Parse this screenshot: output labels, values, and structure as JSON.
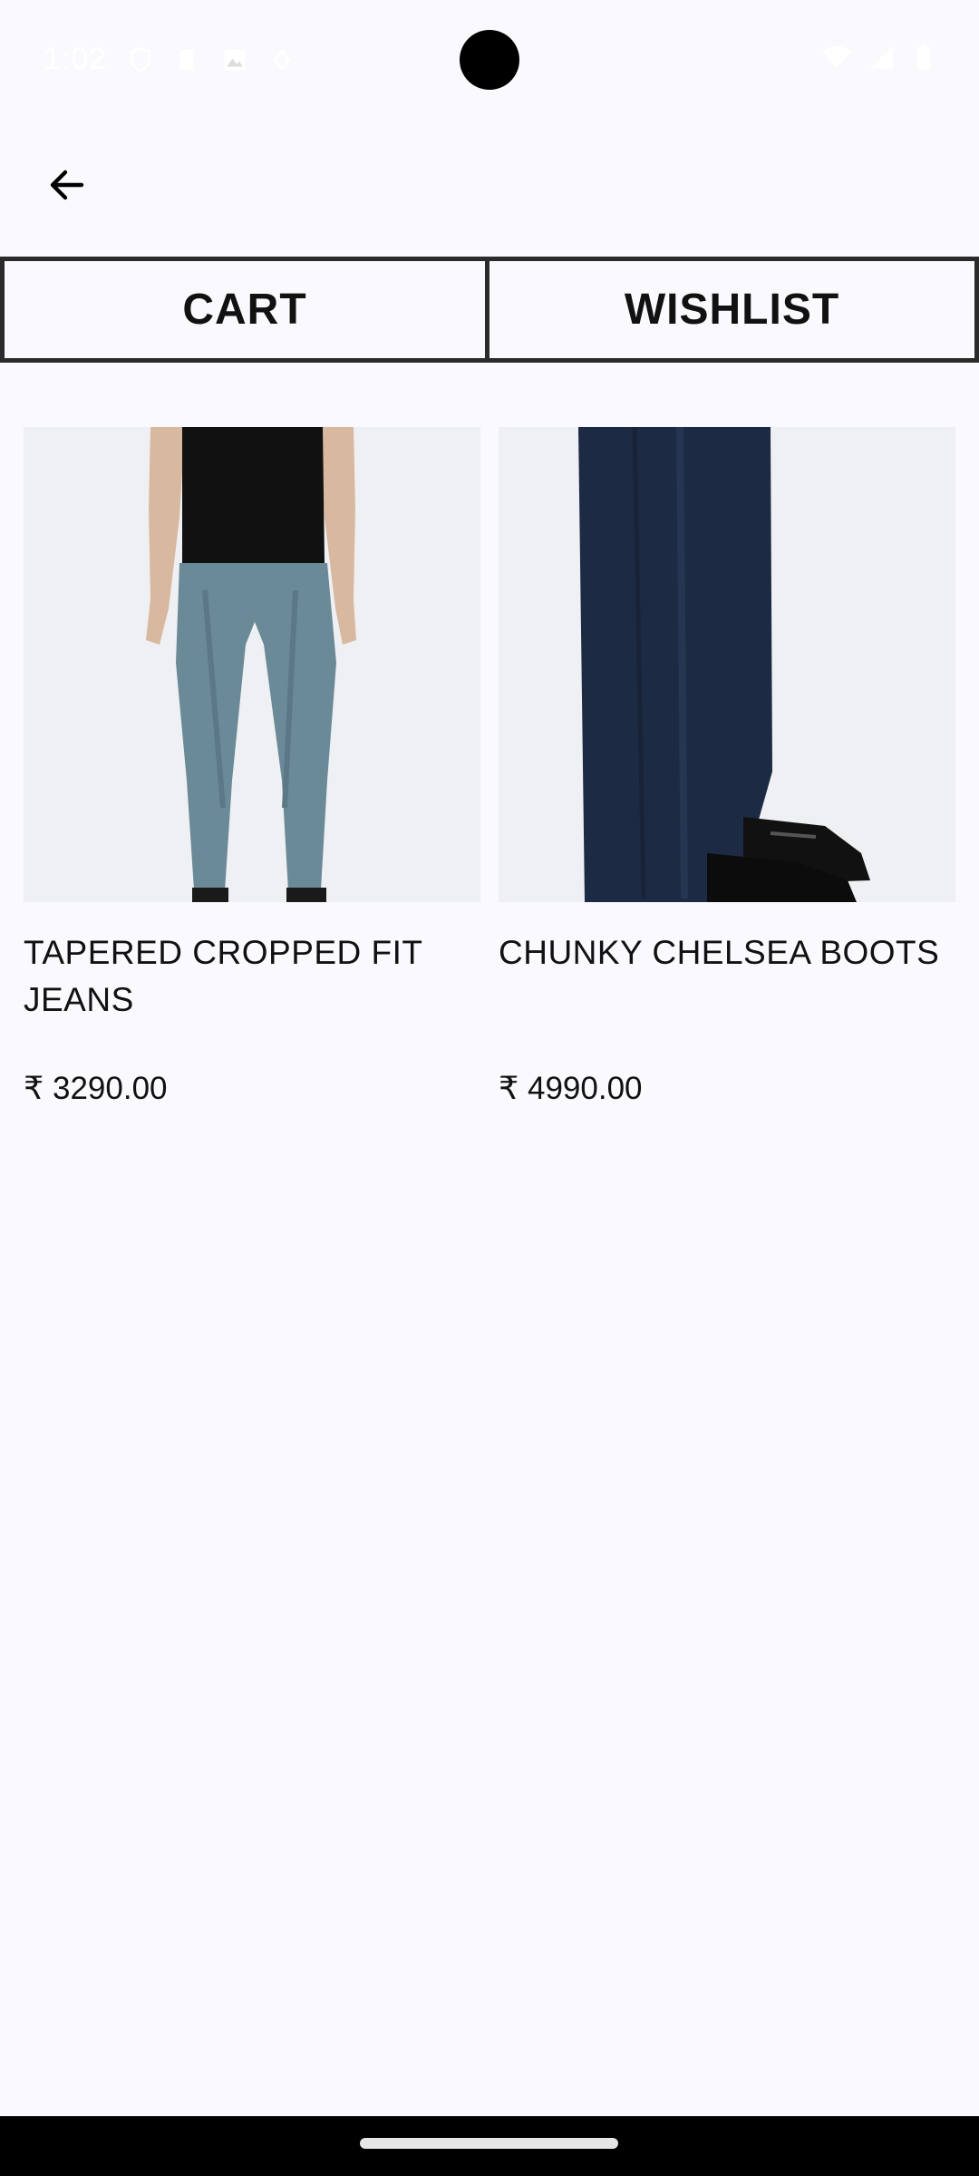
{
  "status_bar": {
    "time": "1:02",
    "left_icons": [
      "shield-icon",
      "sd-card-icon",
      "image-icon",
      "vpn-icon"
    ],
    "right_icons": [
      "wifi-icon",
      "signal-icon",
      "battery-icon"
    ]
  },
  "toolbar": {
    "back_icon": "arrow-left-icon"
  },
  "tabs": [
    {
      "label": "CART"
    },
    {
      "label": "WISHLIST"
    }
  ],
  "products": [
    {
      "title": "TAPERED CROPPED FIT JEANS",
      "price": "₹ 3290.00",
      "image": "jeans-model-photo"
    },
    {
      "title": "CHUNKY CHELSEA BOOTS",
      "price": "₹ 4990.00",
      "image": "boots-photo"
    }
  ],
  "colors": {
    "background": "#faf9fe",
    "tab_border": "#2b2b2b",
    "image_bg": "#eff0f3"
  }
}
